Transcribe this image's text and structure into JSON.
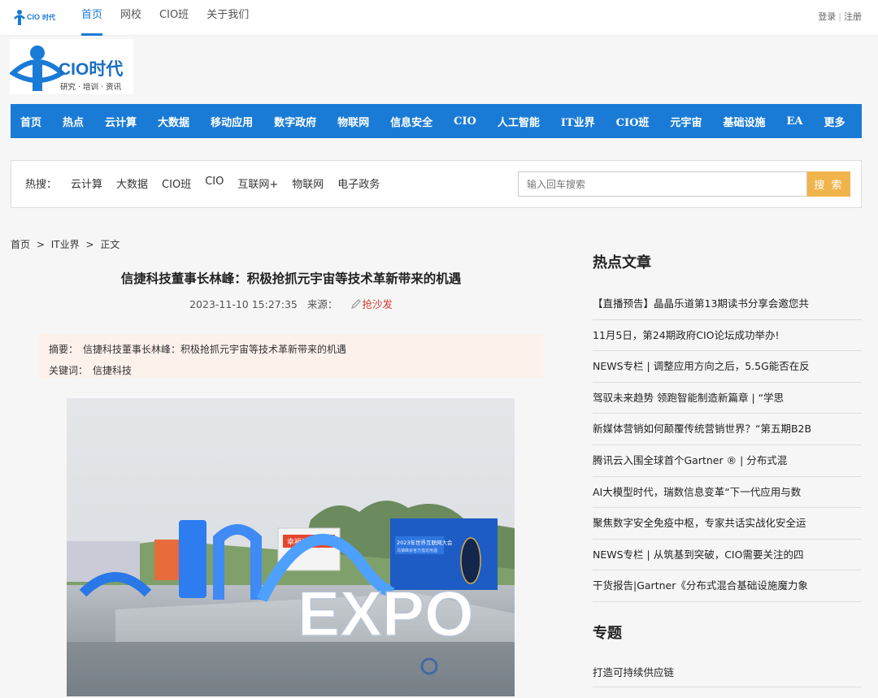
{
  "topbar": {
    "nav": [
      "首页",
      "网校",
      "CIO班",
      "关于我们"
    ],
    "login": "登录",
    "register": "注册",
    "sep": "|"
  },
  "logo": {
    "brand": "CIO时代",
    "tagline": "研究 · 培训 · 资讯"
  },
  "mainnav": [
    "首页",
    "热点",
    "云计算",
    "大数据",
    "移动应用",
    "数字政府",
    "物联网",
    "信息安全",
    "CIO",
    "人工智能",
    "IT业界",
    "CIO班",
    "元宇宙",
    "基础设施",
    "EA",
    "更多"
  ],
  "hot": {
    "label": "热搜：",
    "words": [
      "云计算",
      "大数据",
      "CIO班",
      "CIO",
      "互联网+",
      "物联网",
      "电子政务"
    ]
  },
  "search": {
    "placeholder": "输入回车搜索",
    "button": "搜 索"
  },
  "breadcrumb": [
    "首页",
    ">",
    "IT业界",
    ">",
    "正文"
  ],
  "article": {
    "title": "信捷科技董事长林峰：积极抢抓元宇宙等技术革新带来的机遇",
    "datetime": "2023-11-10 15:27:35",
    "source_label": "来源：",
    "share": "抢沙发",
    "abstract_label": "摘要：",
    "abstract": "信捷科技董事长林峰：积极抢抓元宇宙等技术革新带来的机遇",
    "keywords_label": "关键词：",
    "keywords": "信捷科技"
  },
  "photo": {
    "sign_text": "EXPO",
    "billboard_title": "2023年世界互联网大会",
    "billboard_sub": "乌镇峰会官方指定用酒",
    "banner_text": "幸福到家"
  },
  "sidebar": {
    "hot_title": "热点文章",
    "hot_articles": [
      "【直播预告】晶晶乐道第13期读书分享会邀您共",
      "11月5日，第24期政府CIO论坛成功举办!",
      "NEWS专栏 | 调整应用方向之后，5.5G能否在反",
      "驾驭未来趋势 领跑智能制造新篇章 | “学思",
      "新媒体营销如何颠覆传统营销世界？“第五期B2B",
      "腾讯云入围全球首个Gartner ® | 分布式混",
      "AI大模型时代，瑞数信息变革“下一代应用与数",
      "聚焦数字安全免疫中枢，专家共话实战化安全运",
      "NEWS专栏 | 从筑基到突破，CIO需要关注的四",
      "干货报告|Gartner《分布式混合基础设施魔力象"
    ],
    "topic_title": "专题",
    "topics": [
      "打造可持续供应链"
    ]
  },
  "colors": {
    "brand_blue": "#1a7bd6",
    "search_orange": "#f0b44c",
    "share_red": "#d03b2f"
  }
}
